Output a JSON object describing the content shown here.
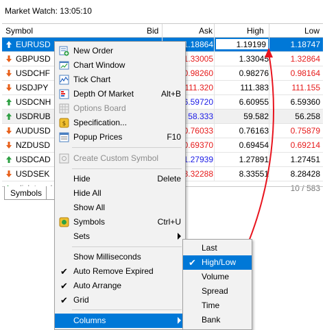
{
  "window": {
    "title": "Market Watch: 13:05:10"
  },
  "table": {
    "headers": [
      "Symbol",
      "Bid",
      "Ask",
      "High",
      "Low"
    ],
    "rows": [
      {
        "symbol": "EURUSD",
        "dir": "up",
        "ask": "1.18864",
        "high": "1.19199",
        "low": "1.18747",
        "ask_c": "up",
        "low_c": "neu"
      },
      {
        "symbol": "GBPUSD",
        "dir": "down",
        "ask": "1.33005",
        "high": "1.33045",
        "low": "1.32864",
        "ask_c": "down",
        "low_c": "down"
      },
      {
        "symbol": "USDCHF",
        "dir": "down",
        "ask": "0.98260",
        "high": "0.98276",
        "low": "0.98164",
        "ask_c": "down",
        "low_c": "down"
      },
      {
        "symbol": "USDJPY",
        "dir": "down",
        "ask": "111.320",
        "high": "111.383",
        "low": "111.155",
        "ask_c": "down",
        "low_c": "down"
      },
      {
        "symbol": "USDCNH",
        "dir": "up",
        "ask": "6.59720",
        "high": "6.60955",
        "low": "6.59360",
        "ask_c": "up",
        "low_c": "neu"
      },
      {
        "symbol": "USDRUB",
        "dir": "up",
        "ask": "58.333",
        "high": "59.582",
        "low": "56.258",
        "ask_c": "up",
        "low_c": "neu"
      },
      {
        "symbol": "AUDUSD",
        "dir": "down",
        "ask": "0.76033",
        "high": "0.76163",
        "low": "0.75879",
        "ask_c": "down",
        "low_c": "down"
      },
      {
        "symbol": "NZDUSD",
        "dir": "down",
        "ask": "0.69370",
        "high": "0.69454",
        "low": "0.69214",
        "ask_c": "down",
        "low_c": "down"
      },
      {
        "symbol": "USDCAD",
        "dir": "up",
        "ask": "1.27939",
        "high": "1.27891",
        "low": "1.27451",
        "ask_c": "up",
        "low_c": "neu"
      },
      {
        "symbol": "USDSEK",
        "dir": "down",
        "ask": "8.32288",
        "high": "8.33551",
        "low": "8.28428",
        "ask_c": "down",
        "low_c": "neu"
      }
    ],
    "add_label": "click to add",
    "count": "10 / 583"
  },
  "tabs": {
    "symbols": "Symbols"
  },
  "context_menu": {
    "new_order": "New Order",
    "chart_window": "Chart Window",
    "tick_chart": "Tick Chart",
    "depth_of_market": "Depth Of Market",
    "depth_shortcut": "Alt+B",
    "options_board": "Options Board",
    "specification": "Specification...",
    "popup_prices": "Popup Prices",
    "popup_shortcut": "F10",
    "create_custom_symbol": "Create Custom Symbol",
    "hide": "Hide",
    "hide_shortcut": "Delete",
    "hide_all": "Hide All",
    "show_all": "Show All",
    "symbols": "Symbols",
    "symbols_shortcut": "Ctrl+U",
    "sets": "Sets",
    "show_milliseconds": "Show Milliseconds",
    "auto_remove_expired": "Auto Remove Expired",
    "auto_arrange": "Auto Arrange",
    "grid": "Grid",
    "columns": "Columns"
  },
  "columns_menu": {
    "last": "Last",
    "high_low": "High/Low",
    "volume": "Volume",
    "spread": "Spread",
    "time": "Time",
    "bank": "Bank"
  },
  "colors": {
    "accent": "#0078d7",
    "up": "#1a1ae6",
    "down": "#e61a1a",
    "annotation": "#e8141e"
  }
}
